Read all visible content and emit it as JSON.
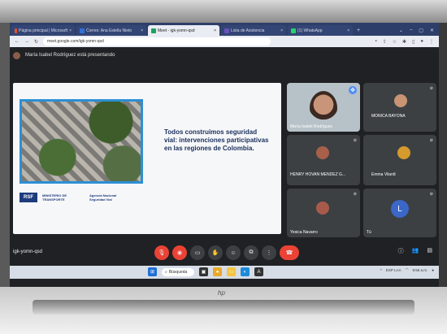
{
  "browser": {
    "tabs": [
      {
        "label": "Página principal | Microsoft",
        "color": "#e84f2b",
        "active": false
      },
      {
        "label": "Correo: Ana Estella Nieto",
        "color": "#2f71d6",
        "active": false
      },
      {
        "label": "Meet - igk-yomn-qsd",
        "color": "#1aa260",
        "active": true
      },
      {
        "label": "Lista de Asistencia",
        "color": "#6b4fbb",
        "active": false
      },
      {
        "label": "(1) WhatsApp",
        "color": "#25d366",
        "active": false
      }
    ],
    "url": "meet.google.com/igk-yomn-qsd"
  },
  "meet": {
    "presenting_text": "María Isabel Rodríguez está presentando",
    "slide": {
      "title": "Todos construimos seguridad vial: intervenciones participativas en las regiones de Colombia.",
      "logos": [
        "RSF",
        "MINISTERIO DE TRANSPORTE",
        "Agencia Nacional Seguridad Vial"
      ]
    },
    "participants": [
      {
        "name": "María Isabel Rodríguez",
        "kind": "video"
      },
      {
        "name": "MONICA BAYONA",
        "kind": "video"
      },
      {
        "name": "HENRY HOVAN MENDEZ G...",
        "kind": "video"
      },
      {
        "name": "Emma Vilardi",
        "kind": "video"
      },
      {
        "name": "Yesica Navarro",
        "kind": "video"
      },
      {
        "name": "Tú",
        "kind": "avatar",
        "initial": "L"
      }
    ],
    "meeting_code": "igk-yomn-qsd"
  },
  "taskbar": {
    "search_label": "Búsqueda",
    "lang": "ESP LAA",
    "time": "9:56 a.m."
  },
  "colors": {
    "accent_blue": "#4f8ff5",
    "hangup_red": "#ea4335"
  }
}
